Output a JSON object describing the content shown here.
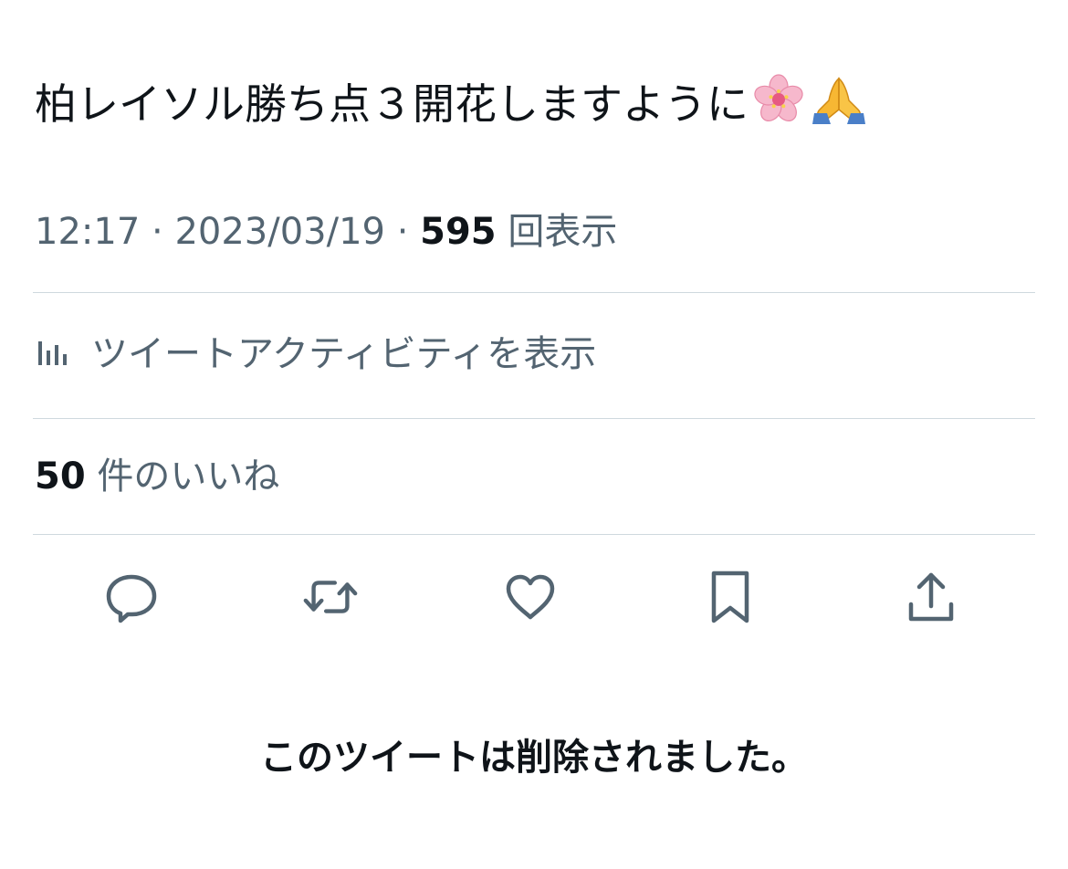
{
  "tweet": {
    "text": "柏レイソル勝ち点３開花しますように",
    "emojis": [
      "cherry-blossom-icon",
      "folded-hands-icon"
    ]
  },
  "meta": {
    "time": "12:17",
    "separator": " · ",
    "date": "2023/03/19",
    "views_count": "595",
    "views_label": "回表示"
  },
  "activity": {
    "label": "ツイートアクティビティを表示",
    "icon": "bar-chart-icon"
  },
  "likes": {
    "count": "50",
    "label": "件のいいね"
  },
  "actions": [
    {
      "name": "reply-icon"
    },
    {
      "name": "retweet-icon"
    },
    {
      "name": "like-icon"
    },
    {
      "name": "bookmark-icon"
    },
    {
      "name": "share-icon"
    }
  ],
  "notice": {
    "deleted": "このツイートは削除されました。"
  },
  "colors": {
    "text": "#0f1419",
    "secondary": "#536471",
    "divider": "#cfd9de"
  }
}
